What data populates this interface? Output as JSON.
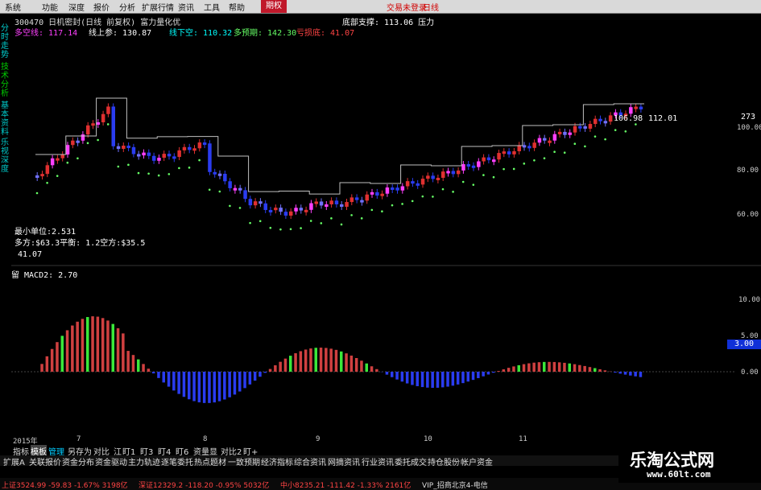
{
  "menu": {
    "items": [
      "系统",
      "功能",
      "深度",
      "报价",
      "分析",
      "扩展行情",
      "资讯",
      "工具",
      "帮助"
    ],
    "active": "期权",
    "right_items": [
      "交易未登录",
      "日线"
    ]
  },
  "stock_header": "300470 日机密封(日线 前复权) 富力量化优",
  "indicators_row": {
    "duokong": "多空线: 117.14",
    "xianshang": "线上参: 130.87",
    "xianxia": "线下空: 110.32",
    "zhicheng": "底部支撑: 113.06 压力",
    "duotou": "多预期: 142.30",
    "kongtou": "亏损底: 41.07"
  },
  "left_tabs": [
    "分时走势",
    "技术分析",
    "基本资料",
    "乐视深度"
  ],
  "price_labels": {
    "high": "106.98",
    "high2": "112.01",
    "right_axis_top": "273",
    "y_ticks": [
      "100.00",
      "80.00",
      "60.00"
    ]
  },
  "price_info": {
    "min_unit": "最小单位:2.531",
    "multi": "多方:$63.3平衡: 1.2空方:$35.5",
    "low": "41.07"
  },
  "macd_label": "留 MACD2: 2.70",
  "macd_ticks": [
    "10.00",
    "5.00",
    "0.00"
  ],
  "macd_value_box": "3.00",
  "x_axis": {
    "year": "2015年",
    "months": [
      "7",
      "8",
      "9",
      "10",
      "11"
    ]
  },
  "tool_row": [
    "指标",
    "模板",
    "管理",
    "另存为",
    "对比",
    "江",
    "盯1",
    "盯3",
    "盯4",
    "盯6",
    "资量显",
    "对比2",
    "盯+"
  ],
  "func_row": [
    "扩展A",
    "关联报价",
    "资金分布",
    "资金驱动",
    "主力轨迹",
    "逐笔委托",
    "热点题材",
    "一致预期",
    "经济指标",
    "综合资讯",
    "网摘资讯",
    "行业资讯",
    "委托成交",
    "持仓股份",
    "帐户资金"
  ],
  "status_bar": {
    "sh": "上证3524.99 -59.83 -1.67% 3198亿",
    "sz": "深证12329.2 -118.20 -0.95% 5032亿",
    "zx": "中小8235.21 -111.42 -1.33% 2161亿",
    "server": "VIP_招商北京4-电信"
  },
  "watermark": {
    "title": "乐淘公式网",
    "url": "www.60lt.com"
  },
  "colors": {
    "up": "#e03030",
    "down": "#2a3cf0",
    "green_bar": "#3ae83a",
    "red_bar": "#d04040",
    "ma": "#c0c0c0"
  }
}
